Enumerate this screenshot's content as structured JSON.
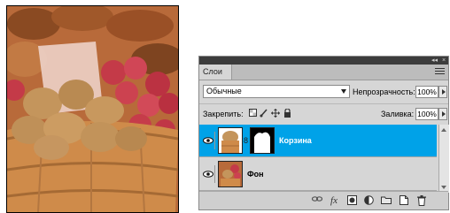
{
  "panel": {
    "tab_label": "Слои",
    "collapse_glyph": "◂◂",
    "close_glyph": "×",
    "blend_mode": "Обычные",
    "opacity_label": "Непрозрачность:",
    "opacity_value": "100%",
    "lock_label": "Закрепить:",
    "fill_label": "Заливка:",
    "fill_value": "100%"
  },
  "layers": [
    {
      "name": "Корзина",
      "selected": true,
      "visible": true,
      "has_mask": true
    },
    {
      "name": "Фон",
      "selected": false,
      "visible": true,
      "has_mask": false
    }
  ],
  "icons": {
    "lock": [
      "lock-transparent-icon",
      "lock-paint-icon",
      "lock-move-icon",
      "lock-all-icon"
    ],
    "bottom": [
      "link-layers-icon",
      "fx-icon",
      "add-mask-icon",
      "adjustment-layer-icon",
      "new-group-icon",
      "new-layer-icon",
      "trash-icon"
    ]
  },
  "glyphs": {
    "fx": "fx",
    "chain": "8"
  },
  "colors": {
    "selection": "#00a2e8"
  }
}
